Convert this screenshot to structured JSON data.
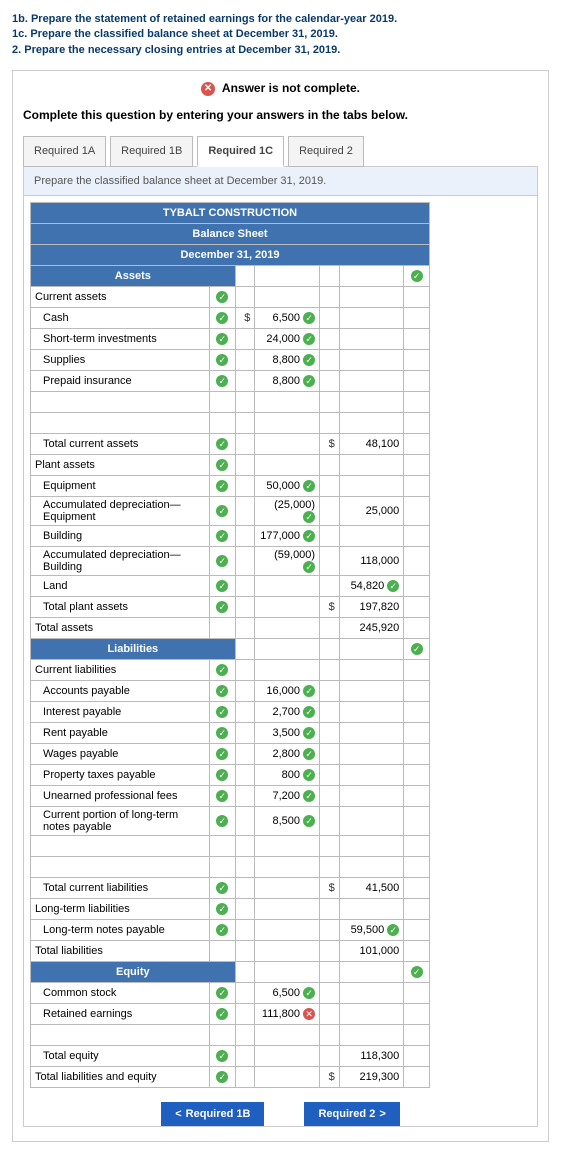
{
  "instructions": {
    "l1": "1b. Prepare the statement of retained earnings for the calendar-year 2019.",
    "l2": "1c. Prepare the classified balance sheet at December 31, 2019.",
    "l3": "2. Prepare the necessary closing entries at December 31, 2019."
  },
  "notComplete": "Answer is not complete.",
  "completePrompt": "Complete this question by entering your answers in the tabs below.",
  "tabs": {
    "t1": "Required 1A",
    "t2": "Required 1B",
    "t3": "Required 1C",
    "t4": "Required 2"
  },
  "prompt": "Prepare the classified balance sheet at December 31, 2019.",
  "header": {
    "h1": "TYBALT CONSTRUCTION",
    "h2": "Balance Sheet",
    "h3": "December 31, 2019"
  },
  "sections": {
    "assets": "Assets",
    "liab": "Liabilities",
    "equity": "Equity"
  },
  "rows": {
    "cur_assets": "Current assets",
    "cash": "Cash",
    "cash_v": "6,500",
    "sti": "Short-term investments",
    "sti_v": "24,000",
    "sup": "Supplies",
    "sup_v": "8,800",
    "ppi": "Prepaid insurance",
    "ppi_v": "8,800",
    "tca": "Total current assets",
    "tca_v": "48,100",
    "plant": "Plant assets",
    "equip": "Equipment",
    "equip_v": "50,000",
    "adep_e": "Accumulated depreciation—Equipment",
    "adep_e_v": "(25,000)",
    "equip_net": "25,000",
    "bldg": "Building",
    "bldg_v": "177,000",
    "adep_b": "Accumulated depreciation—Building",
    "adep_b_v": "(59,000)",
    "bldg_net": "118,000",
    "land": "Land",
    "land_v": "54,820",
    "tpa": "Total plant assets",
    "tpa_v": "197,820",
    "ta": "Total assets",
    "ta_v": "245,920",
    "cur_liab": "Current liabilities",
    "ap": "Accounts payable",
    "ap_v": "16,000",
    "ip": "Interest payable",
    "ip_v": "2,700",
    "rp": "Rent payable",
    "rp_v": "3,500",
    "wp": "Wages payable",
    "wp_v": "2,800",
    "ptp": "Property taxes payable",
    "ptp_v": "800",
    "upf": "Unearned professional fees",
    "upf_v": "7,200",
    "cpl": "Current portion of long-term notes payable",
    "cpl_v": "8,500",
    "tcl": "Total current liabilities",
    "tcl_v": "41,500",
    "ltl": "Long-term liabilities",
    "ltnp": "Long-term notes payable",
    "ltnp_v": "59,500",
    "tl": "Total liabilities",
    "tl_v": "101,000",
    "cs": "Common stock",
    "cs_v": "6,500",
    "re": "Retained earnings",
    "re_v": "111,800",
    "te": "Total equity",
    "te_v": "118,300",
    "tle": "Total liabilities and equity",
    "tle_v": "219,300"
  },
  "dollar": "$",
  "nav": {
    "prev": "Required 1B",
    "next": "Required 2"
  }
}
